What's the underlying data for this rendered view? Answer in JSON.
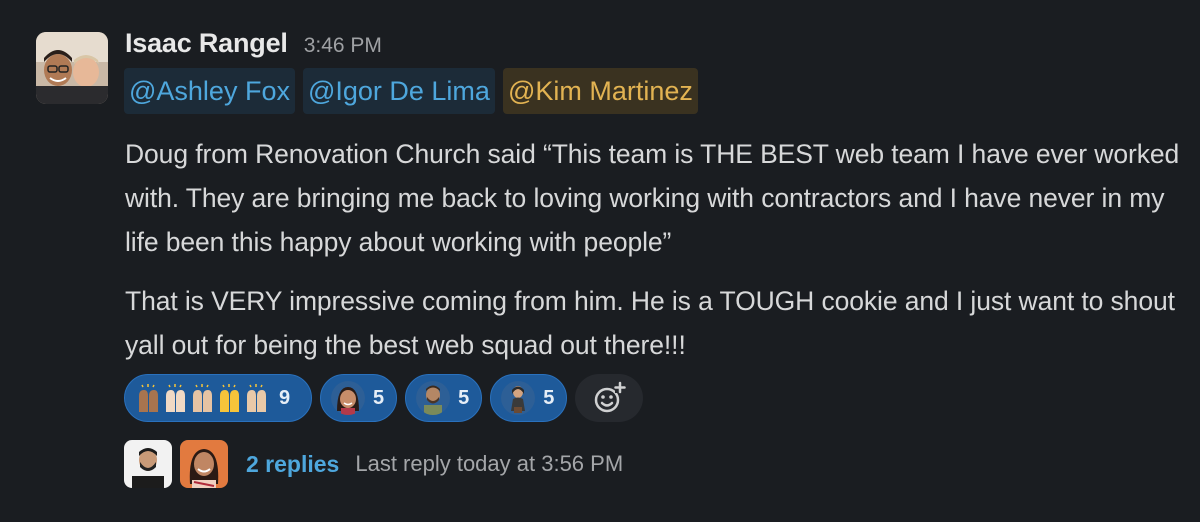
{
  "message": {
    "sender": "Isaac Rangel",
    "time": "3:46 PM",
    "mentions": [
      "@Ashley Fox",
      "@Igor De Lima",
      "@Kim Martinez"
    ],
    "paragraphs": [
      "Doug from Renovation Church said “This team is THE BEST web team I have ever worked with. They are bringing me back to loving working with contractors and I have never in my life been this happy about working with people”",
      "That is VERY impressive coming from him. He is a TOUGH cookie and I just want to shout yall out for being the best web squad out there!!!"
    ]
  },
  "reactions": [
    {
      "icon": "raised-hands-emoji-group",
      "count": "9"
    },
    {
      "icon": "custom-face-emoji-woman",
      "count": "5"
    },
    {
      "icon": "custom-face-emoji-man",
      "count": "5"
    },
    {
      "icon": "custom-face-emoji-person",
      "count": "5"
    }
  ],
  "thread": {
    "replies_label": "2 replies",
    "last_reply": "Last reply today at 3:56 PM"
  },
  "colors": {
    "background": "#1a1d21",
    "mention_blue": "#4ea7dd",
    "mention_self": "#e2b352",
    "reaction_active": "#1e5a9a"
  }
}
